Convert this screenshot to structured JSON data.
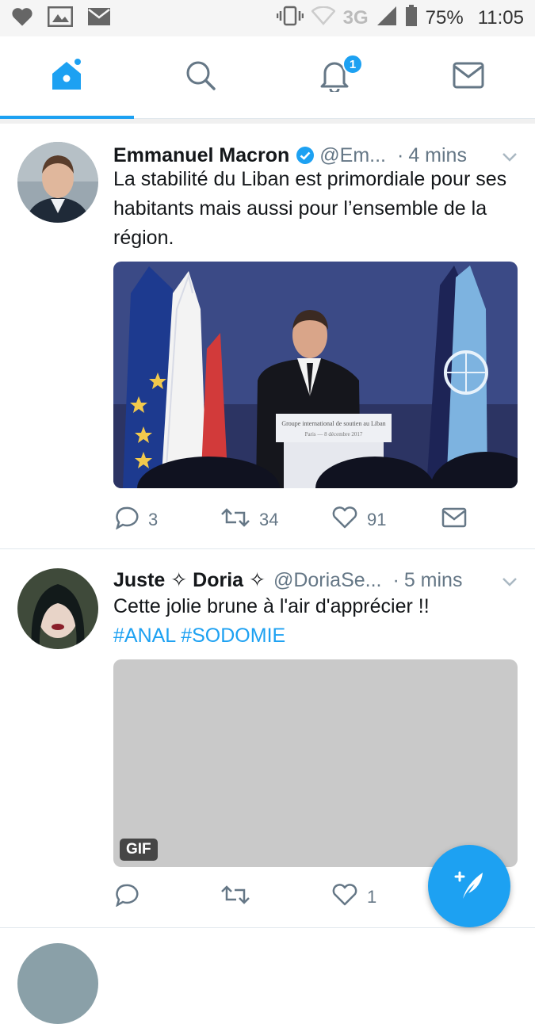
{
  "status_bar": {
    "network": "3G",
    "battery": "75%",
    "time": "11:05"
  },
  "tabs": {
    "notifications_badge": "1"
  },
  "tweets": [
    {
      "name": "Emmanuel Macron",
      "verified": true,
      "handle": "@Em...",
      "dot": "·",
      "time": "4 mins",
      "text": "La stabilité du Liban est primordiale pour ses habitants mais aussi pour l’ensemble de la région.",
      "media_sign": "Groupe international de soutien au Liban",
      "media_sign_sub": "Paris — 8 décembre 2017",
      "replies": "3",
      "retweets": "34",
      "likes": "91"
    },
    {
      "name": "Juste ✧ Doria ✧",
      "handle": "@DoriaSe...",
      "dot": "·",
      "time": "5 mins",
      "text": "Cette jolie brune à l'air d'apprécier !!",
      "hashtags": "#ANAL #SODOMIE",
      "media_label": "GIF",
      "replies": "",
      "retweets": "",
      "likes": "1"
    }
  ],
  "colors": {
    "accent": "#1da1f2",
    "muted": "#657786"
  }
}
